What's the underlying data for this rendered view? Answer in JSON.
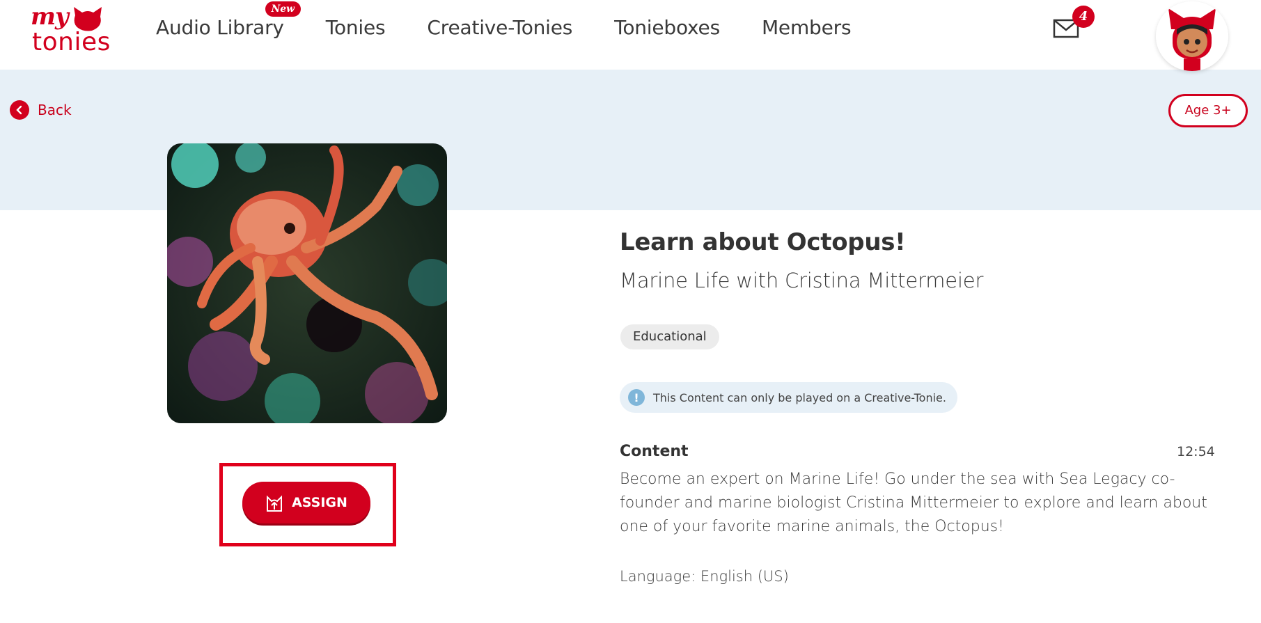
{
  "header": {
    "logo": {
      "top": "my",
      "bottom": "tonies"
    },
    "nav": [
      {
        "label": "Audio Library",
        "badge": "New"
      },
      {
        "label": "Tonies"
      },
      {
        "label": "Creative-Tonies"
      },
      {
        "label": "Tonieboxes"
      },
      {
        "label": "Members"
      }
    ],
    "mail_count": "4",
    "brand_color": "#d2001e"
  },
  "hero": {
    "back_label": "Back",
    "age_label": "Age 3+"
  },
  "content": {
    "assign_label": "ASSIGN",
    "title": "Learn about Octopus!",
    "subtitle": "Marine Life with Cristina Mittermeier",
    "tag": "Educational",
    "info_text": "This Content can only be played on a Creative-Tonie.",
    "content_label": "Content",
    "duration": "12:54",
    "description": "Become an expert on Marine Life! Go under the sea with Sea Legacy co-founder and marine biologist Cristina Mittermeier to explore and learn about one of your favorite marine animals, the Octopus!",
    "language": "Language: English (US)"
  }
}
